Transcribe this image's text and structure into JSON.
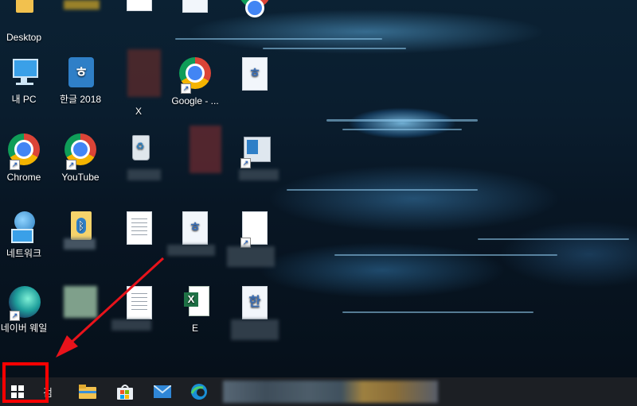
{
  "desktop": {
    "icons": [
      {
        "label": "Desktop"
      },
      {
        "label": "내 PC"
      },
      {
        "label": "한글 2018"
      },
      {
        "label": "Chrome"
      },
      {
        "label": "YouTube"
      },
      {
        "label": "네트워크"
      },
      {
        "label": "네이버 웨일"
      },
      {
        "label": "X"
      },
      {
        "label": "Google - ..."
      },
      {
        "label": "E"
      },
      {
        "label": "한"
      }
    ]
  },
  "taskbar": {
    "search_glyph": "검"
  },
  "colors": {
    "highlight": "#ff0000",
    "taskbar": "#1c1f24"
  },
  "icons": {
    "start": "windows-start-icon",
    "explorer": "folder-icon",
    "store": "store-icon",
    "mail": "mail-icon",
    "edge": "edge-icon"
  }
}
